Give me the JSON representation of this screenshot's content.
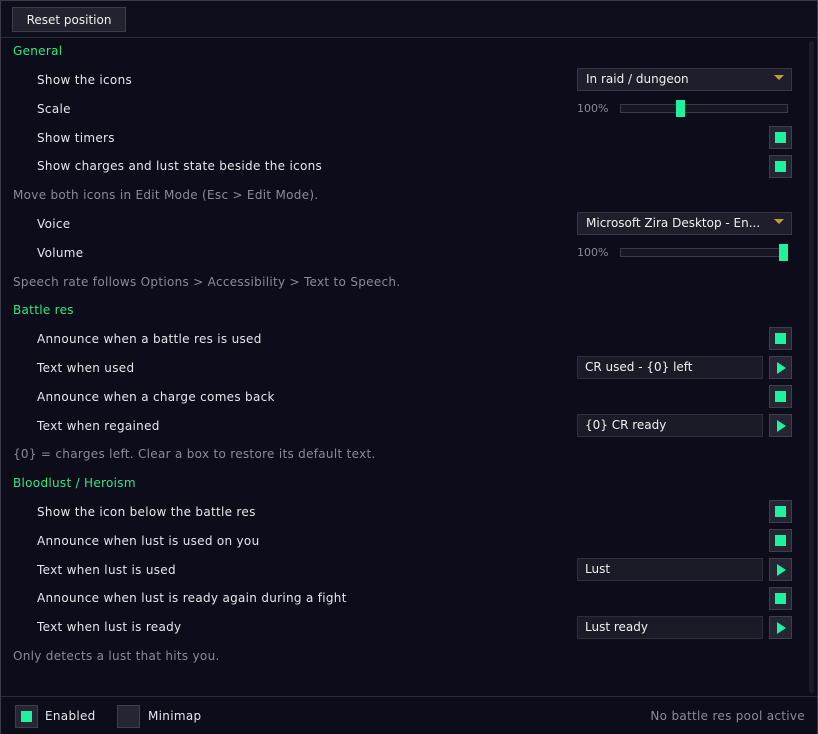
{
  "toolbar": {
    "reset_label": "Reset position"
  },
  "general": {
    "heading": "General",
    "show_icons": {
      "label": "Show the icons",
      "value": "In raid / dungeon"
    },
    "scale": {
      "label": "Scale",
      "percent_text": "100%",
      "level_fraction": 0.35
    },
    "show_timers": {
      "label": "Show timers",
      "checked": true
    },
    "show_charges": {
      "label": "Show charges and lust state beside the icons",
      "checked": true
    },
    "note_move": "Move both icons in Edit Mode (Esc > Edit Mode).",
    "voice": {
      "label": "Voice",
      "value": "Microsoft Zira Desktop - En..."
    },
    "volume": {
      "label": "Volume",
      "percent_text": "100%",
      "level_fraction": 1.0
    },
    "note_speech": "Speech rate follows Options > Accessibility > Text to Speech."
  },
  "battle_res": {
    "heading": "Battle res",
    "announce_used": {
      "label": "Announce when a battle res is used",
      "checked": true
    },
    "text_used": {
      "label": "Text when used",
      "value": "CR used - {0} left"
    },
    "announce_back": {
      "label": "Announce when a charge comes back",
      "checked": true
    },
    "text_regained": {
      "label": "Text when regained",
      "value": "{0} CR ready"
    },
    "note": "{0} = charges left. Clear a box to restore its default text."
  },
  "bloodlust": {
    "heading": "Bloodlust / Heroism",
    "show_icon_below": {
      "label": "Show the icon below the battle res",
      "checked": true
    },
    "announce_used": {
      "label": "Announce when lust is used on you",
      "checked": true
    },
    "text_used": {
      "label": "Text when lust is used",
      "value": "Lust"
    },
    "announce_ready": {
      "label": "Announce when lust is ready again during a fight",
      "checked": true
    },
    "text_ready": {
      "label": "Text when lust is ready",
      "value": "Lust ready"
    },
    "note": "Only detects a lust that hits you."
  },
  "footer": {
    "enabled": {
      "label": "Enabled",
      "checked": true
    },
    "minimap": {
      "label": "Minimap",
      "checked": false
    },
    "status": "No battle res pool active"
  },
  "icons": {
    "dropdown": "chevron-down-icon",
    "play": "play-icon",
    "check": "checkbox-mark-icon"
  },
  "colors": {
    "accent": "#1ef29c",
    "section": "#2ee884",
    "muted": "#8a8a98",
    "dropdown_arrow": "#c89a3a"
  }
}
